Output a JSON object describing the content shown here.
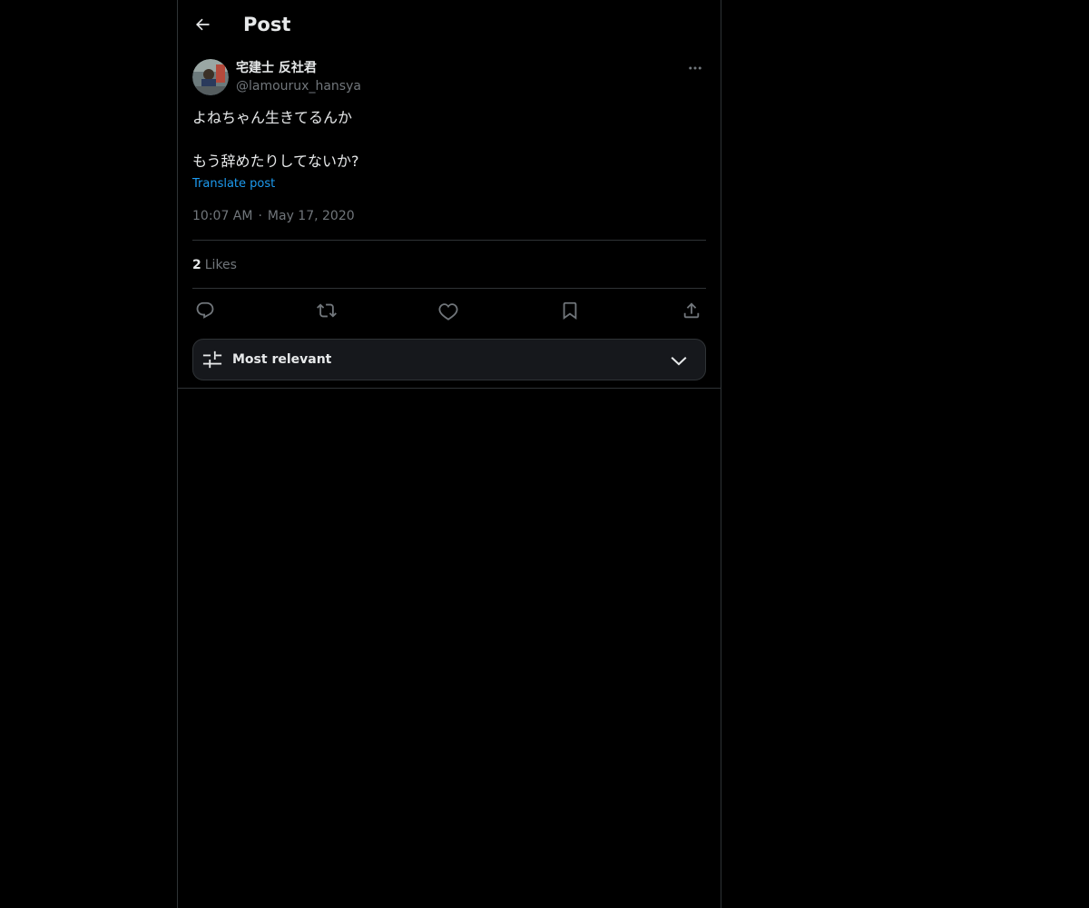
{
  "header": {
    "title": "Post",
    "back_icon": "arrow-left-icon"
  },
  "post": {
    "author": {
      "display_name": "宅建士 反社君",
      "handle": "@lamourux_hansya"
    },
    "text_lines": [
      "よねちゃん生きてるんか",
      "",
      "もう辞めたりしてないか?"
    ],
    "translate_label": "Translate post",
    "time": "10:07 AM",
    "separator": "·",
    "date": "May 17, 2020",
    "likes": {
      "count": "2",
      "label": "Likes"
    },
    "actions": [
      "reply-icon",
      "repost-icon",
      "like-icon",
      "bookmark-icon",
      "share-icon"
    ]
  },
  "sort": {
    "label": "Most relevant",
    "icon": "sliders-icon",
    "chevron": "chevron-down-icon"
  },
  "colors": {
    "background": "#000000",
    "text_primary": "#e7e9ea",
    "text_secondary": "#71767b",
    "link": "#1d9bf0",
    "border": "#2f3336"
  }
}
